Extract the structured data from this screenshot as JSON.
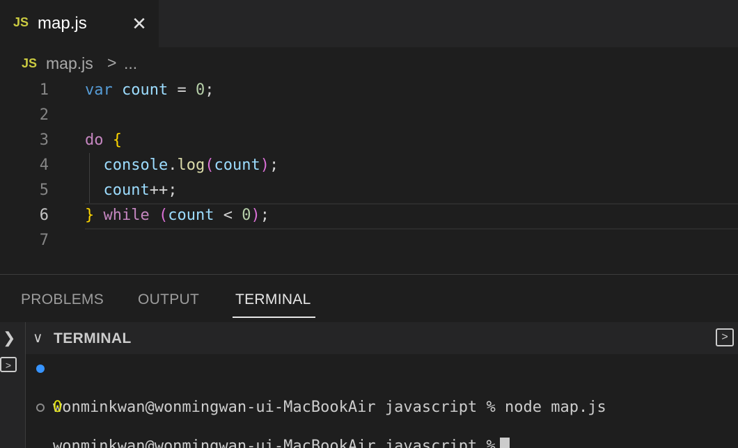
{
  "tab": {
    "badge": "JS",
    "label": "map.js",
    "close": "✕"
  },
  "breadcrumb": {
    "badge": "JS",
    "file": "map.js",
    "separator": ">",
    "more": "..."
  },
  "editor": {
    "line_numbers": [
      "1",
      "2",
      "3",
      "4",
      "5",
      "6",
      "7"
    ],
    "active_line": "6"
  },
  "code": {
    "l1": {
      "kw": "var",
      "var": "count",
      "op": "=",
      "num": "0",
      "end": ";"
    },
    "l3": {
      "kw": "do",
      "brace": "{"
    },
    "l4": {
      "obj": "console",
      "dot": ".",
      "fn": "log",
      "open": "(",
      "arg": "count",
      "close": ")",
      "end": ";"
    },
    "l5": {
      "var": "count",
      "op": "++;"
    },
    "l6": {
      "brace": "}",
      "kw": "while",
      "open": "(",
      "var": "count",
      "op": "<",
      "num": "0",
      "close": ")",
      "end": ";"
    }
  },
  "panel": {
    "tabs": [
      "PROBLEMS",
      "OUTPUT",
      "TERMINAL"
    ],
    "active_tab": "TERMINAL"
  },
  "terminal": {
    "title": "TERMINAL",
    "lines": [
      {
        "prompt": "wonminkwan@wonmingwan-ui-MacBookAir",
        "dir": "javascript",
        "symbol": "%",
        "command": "node map.js"
      },
      {
        "output": "0"
      },
      {
        "prompt": "wonminkwan@wonmingwan-ui-MacBookAir",
        "dir": "javascript",
        "symbol": "%",
        "command": ""
      }
    ]
  },
  "colors": {
    "keyword": "#569cd6",
    "control": "#c586c0",
    "variable": "#9cdcfe",
    "number": "#b5cea8",
    "function": "#dcdcaa",
    "bracket_gold": "#ffd700",
    "bracket_orchid": "#da70d6",
    "js_badge": "#cbcb41",
    "status_dot": "#3794ff"
  }
}
